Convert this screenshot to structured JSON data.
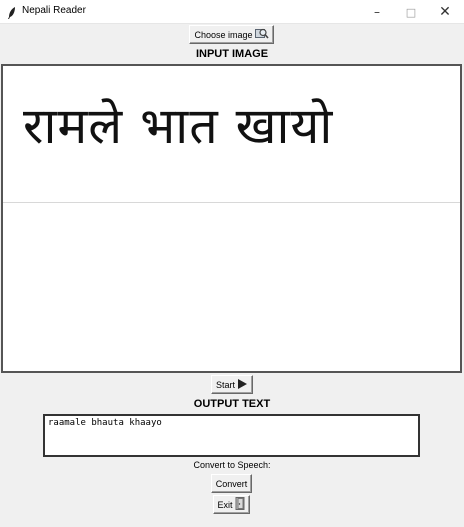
{
  "window": {
    "title": "Nepali Reader",
    "controls": {
      "minimize": "–",
      "maximize": "□",
      "close": "✕"
    }
  },
  "toolbar": {
    "choose_image_label": "Choose image"
  },
  "input_section": {
    "heading": "INPUT IMAGE",
    "image_text": "रामले भात खायो"
  },
  "actions": {
    "start_label": "Start",
    "convert_label": "Convert",
    "exit_label": "Exit"
  },
  "output_section": {
    "heading": "OUTPUT TEXT",
    "value": "raamale bhauta khaayo",
    "convert_caption": "Convert to Speech:"
  },
  "icons": {
    "app": "feather-icon",
    "choose_image": "magnifier-image-icon",
    "start": "play-arrow-icon",
    "exit": "door-exit-icon"
  }
}
